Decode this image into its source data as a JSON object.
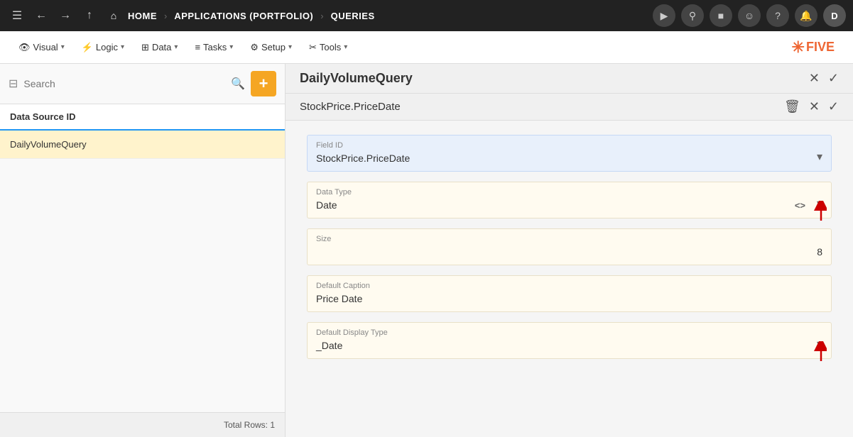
{
  "topNav": {
    "hamburger_label": "☰",
    "back_label": "←",
    "forward_label": "→",
    "up_label": "↑",
    "home_label": "⌂",
    "home_text": "HOME",
    "sep1": "›",
    "breadcrumb1": "APPLICATIONS (PORTFOLIO)",
    "sep2": "›",
    "breadcrumb2": "QUERIES",
    "play_label": "▶",
    "search_label": "⚲",
    "stop_label": "■",
    "robot_label": "☺",
    "help_label": "?",
    "bell_label": "🔔",
    "avatar_label": "D"
  },
  "secondNav": {
    "items": [
      {
        "icon": "👁",
        "label": "Visual",
        "id": "visual"
      },
      {
        "icon": "⚡",
        "label": "Logic",
        "id": "logic"
      },
      {
        "icon": "⊞",
        "label": "Data",
        "id": "data"
      },
      {
        "icon": "≡",
        "label": "Tasks",
        "id": "tasks"
      },
      {
        "icon": "⚙",
        "label": "Setup",
        "id": "setup"
      },
      {
        "icon": "✂",
        "label": "Tools",
        "id": "tools"
      }
    ],
    "logo_text": "FIVE"
  },
  "sidebar": {
    "search_placeholder": "Search",
    "search_icon": "🔍",
    "add_label": "+",
    "header": "Data Source ID",
    "items": [
      {
        "label": "DailyVolumeQuery",
        "active": true
      }
    ],
    "footer": "Total Rows: 1"
  },
  "content": {
    "title": "DailyVolumeQuery",
    "close_label": "✕",
    "check_label": "✓",
    "sub_title": "StockPrice.PriceDate",
    "delete_label": "🗑",
    "sub_close_label": "✕",
    "sub_check_label": "✓",
    "form": {
      "field_id_label": "Field ID",
      "field_id_value": "StockPrice.PriceDate",
      "data_type_label": "Data Type",
      "data_type_value": "Date",
      "size_label": "Size",
      "size_value": "8",
      "default_caption_label": "Default Caption",
      "default_caption_value": "Price Date",
      "default_display_label": "Default Display Type",
      "default_display_value": "_Date"
    }
  }
}
